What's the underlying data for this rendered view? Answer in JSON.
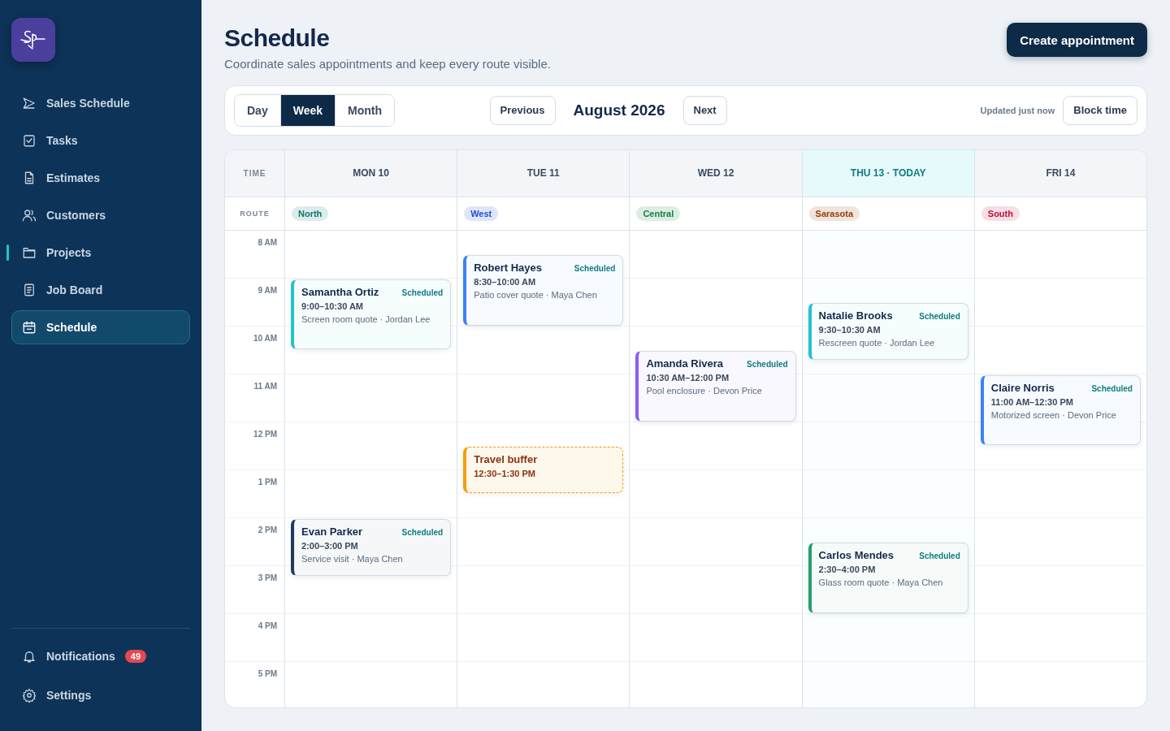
{
  "sidebar": {
    "items": [
      {
        "label": "Sales Schedule",
        "selected": false,
        "highlighted": false
      },
      {
        "label": "Tasks",
        "selected": false,
        "highlighted": false
      },
      {
        "label": "Estimates",
        "selected": false,
        "highlighted": false
      },
      {
        "label": "Customers",
        "selected": false,
        "highlighted": false
      },
      {
        "label": "Projects",
        "selected": false,
        "highlighted": true
      },
      {
        "label": "Job Board",
        "selected": false,
        "highlighted": false
      },
      {
        "label": "Schedule",
        "selected": true,
        "highlighted": false
      }
    ],
    "footer": [
      {
        "label": "Notifications",
        "badge": "49"
      },
      {
        "label": "Settings"
      }
    ]
  },
  "header": {
    "title": "Schedule",
    "subtitle": "Coordinate sales appointments and keep every route visible.",
    "action": "Create appointment"
  },
  "toolbar": {
    "views": [
      {
        "label": "Day",
        "selected": false
      },
      {
        "label": "Week",
        "selected": true
      },
      {
        "label": "Month",
        "selected": false
      }
    ],
    "previous": "Previous",
    "period": "August 2026",
    "next": "Next",
    "updated": "Updated just now",
    "block": "Block time"
  },
  "calendar": {
    "time_label": "TIME",
    "route_label": "ROUTE",
    "hours": [
      "8 AM",
      "9 AM",
      "10 AM",
      "11 AM",
      "12 PM",
      "1 PM",
      "2 PM",
      "3 PM",
      "4 PM",
      "5 PM"
    ],
    "days": [
      {
        "label": "MON 10",
        "today": false,
        "route": {
          "label": "North",
          "color": "#0f766e"
        },
        "events": [
          {
            "kind": "appointment",
            "name": "Samantha Ortiz",
            "status": "Scheduled",
            "time": "9:00–10:30 AM",
            "detail": "Screen room quote · Jordan Lee",
            "color": "#22c3c9"
          },
          {
            "kind": "appointment",
            "name": "Evan Parker",
            "status": "Scheduled",
            "time": "2:00–3:00 PM",
            "detail": "Service visit · Maya Chen",
            "color": "#1e3a5f"
          }
        ]
      },
      {
        "label": "TUE 11",
        "today": false,
        "route": {
          "label": "West",
          "color": "#1d4ed8"
        },
        "events": [
          {
            "kind": "appointment",
            "name": "Robert Hayes",
            "status": "Scheduled",
            "time": "8:30–10:00 AM",
            "detail": "Patio cover quote · Maya Chen",
            "color": "#3b82f6"
          },
          {
            "kind": "buffer",
            "name": "Travel buffer",
            "time": "12:30–1:30 PM",
            "color": "#f59e0b"
          }
        ]
      },
      {
        "label": "WED 12",
        "today": false,
        "route": {
          "label": "Central",
          "color": "#15803d"
        },
        "events": [
          {
            "kind": "appointment",
            "name": "Amanda Rivera",
            "status": "Scheduled",
            "time": "10:30 AM–12:00 PM",
            "detail": "Pool enclosure · Devon Price",
            "color": "#8b5cf6"
          }
        ]
      },
      {
        "label": "THU 13 · TODAY",
        "today": true,
        "route": {
          "label": "Sarasota",
          "color": "#92400e"
        },
        "events": [
          {
            "kind": "appointment",
            "name": "Natalie Brooks",
            "status": "Scheduled",
            "time": "9:30–10:30 AM",
            "detail": "Rescreen quote · Jordan Lee",
            "color": "#22c3c9"
          },
          {
            "kind": "appointment",
            "name": "Carlos Mendes",
            "status": "Scheduled",
            "time": "2:30–4:00 PM",
            "detail": "Glass room quote · Maya Chen",
            "color": "#22a06b"
          }
        ]
      },
      {
        "label": "FRI 14",
        "today": false,
        "route": {
          "label": "South",
          "color": "#be123c"
        },
        "events": [
          {
            "kind": "appointment",
            "name": "Claire Norris",
            "status": "Scheduled",
            "time": "11:00 AM–12:30 PM",
            "detail": "Motorized screen · Devon Price",
            "color": "#3b82f6"
          }
        ]
      }
    ]
  }
}
